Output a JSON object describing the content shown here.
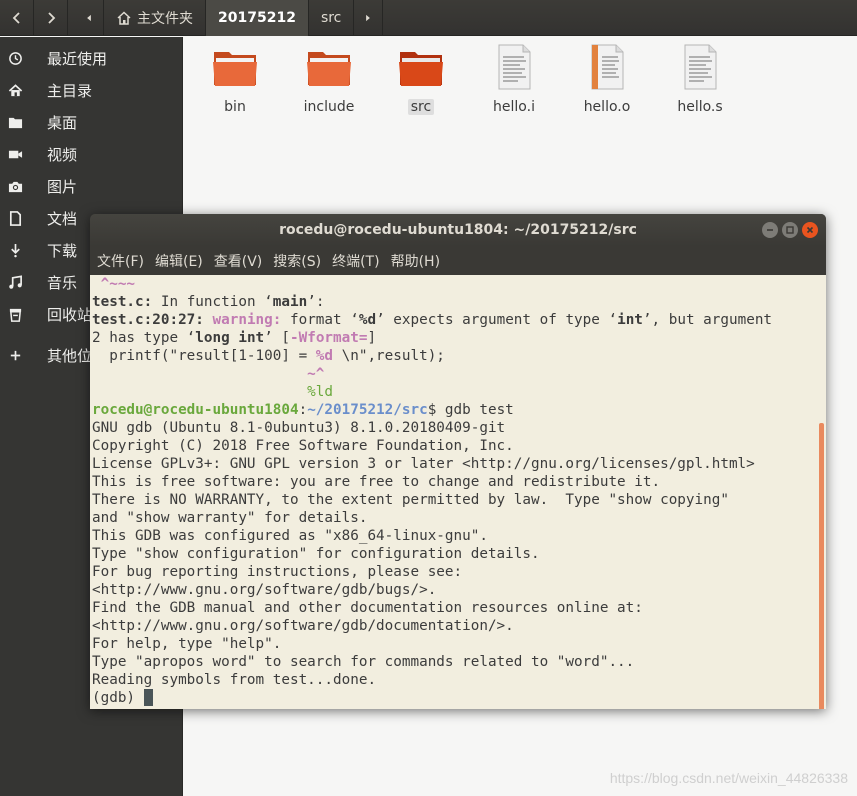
{
  "nav": {
    "crumbs": [
      {
        "label": "主文件夹"
      },
      {
        "label": "20175212"
      },
      {
        "label": "src"
      }
    ]
  },
  "sidebar": {
    "items": [
      {
        "label": "最近使用",
        "icon": "clock-icon"
      },
      {
        "label": "主目录",
        "icon": "home-icon"
      },
      {
        "label": "桌面",
        "icon": "folder-icon"
      },
      {
        "label": "视频",
        "icon": "video-icon"
      },
      {
        "label": "图片",
        "icon": "camera-icon"
      },
      {
        "label": "文档",
        "icon": "document-icon"
      },
      {
        "label": "下载",
        "icon": "download-icon"
      },
      {
        "label": "音乐",
        "icon": "music-icon"
      },
      {
        "label": "回收站",
        "icon": "trash-icon"
      },
      {
        "label": "其他位置",
        "icon": "plus-icon"
      }
    ]
  },
  "files": [
    {
      "name": "bin",
      "type": "folder"
    },
    {
      "name": "include",
      "type": "folder"
    },
    {
      "name": "src",
      "type": "folder",
      "selected": true
    },
    {
      "name": "hello.i",
      "type": "text"
    },
    {
      "name": "hello.o",
      "type": "object"
    },
    {
      "name": "hello.s",
      "type": "text"
    }
  ],
  "terminal": {
    "title": "rocedu@rocedu-ubuntu1804: ~/20175212/src",
    "menu": [
      "文件(F)",
      "编辑(E)",
      "查看(V)",
      "搜索(S)",
      "终端(T)",
      "帮助(H)"
    ],
    "lines": {
      "l0": " ^~~~",
      "l1a": "test.c:",
      "l1b": " In function ‘",
      "l1c": "main",
      "l1d": "’:",
      "l2a": "test.c:20:27: ",
      "l2b": "warning: ",
      "l2c": "format ‘",
      "l2d": "%d",
      "l2e": "’ expects argument of type ‘",
      "l2f": "int",
      "l2g": "’, but argument",
      "l3a": "2 has type ‘",
      "l3b": "long int",
      "l3c": "’ [",
      "l3d": "-Wformat=",
      "l3e": "]",
      "l4a": "  printf(\"result[1-100] = ",
      "l4b": "%d",
      "l4c": " \\n\",result);",
      "l5": "                         ~^",
      "l6": "                         %ld",
      "l7a": "rocedu@rocedu-ubuntu1804",
      "l7b": ":",
      "l7c": "~/20175212/src",
      "l7d": "$ gdb test",
      "l8": "GNU gdb (Ubuntu 8.1-0ubuntu3) 8.1.0.20180409-git",
      "l9": "Copyright (C) 2018 Free Software Foundation, Inc.",
      "l10": "License GPLv3+: GNU GPL version 3 or later <http://gnu.org/licenses/gpl.html>",
      "l11": "This is free software: you are free to change and redistribute it.",
      "l12": "There is NO WARRANTY, to the extent permitted by law.  Type \"show copying\"",
      "l13": "and \"show warranty\" for details.",
      "l14": "This GDB was configured as \"x86_64-linux-gnu\".",
      "l15": "Type \"show configuration\" for configuration details.",
      "l16": "For bug reporting instructions, please see:",
      "l17": "<http://www.gnu.org/software/gdb/bugs/>.",
      "l18": "Find the GDB manual and other documentation resources online at:",
      "l19": "<http://www.gnu.org/software/gdb/documentation/>.",
      "l20": "For help, type \"help\".",
      "l21": "Type \"apropos word\" to search for commands related to \"word\"...",
      "l22": "Reading symbols from test...done.",
      "l23": "(gdb) "
    }
  },
  "watermark": "https://blog.csdn.net/weixin_44826338",
  "colors": {
    "terminal_bg": "#f2eedf",
    "accent_orange": "#e95420",
    "sidebar_bg": "#353533",
    "warning": "#c17bb2",
    "prompt_user": "#6aa83c",
    "prompt_path": "#6a8ecb"
  }
}
